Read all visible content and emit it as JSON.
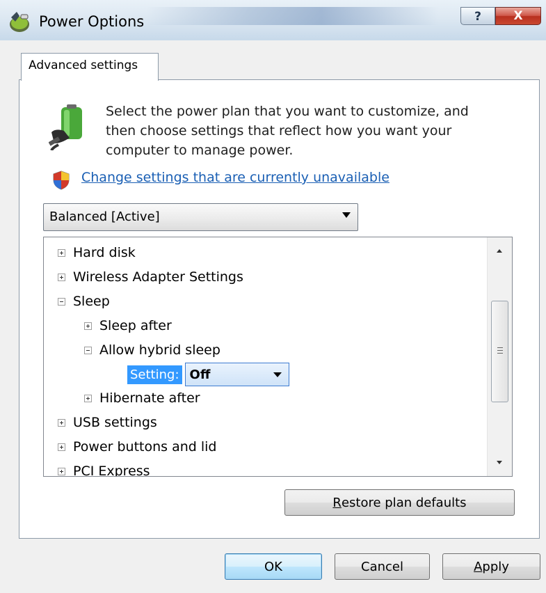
{
  "window": {
    "title": "Power Options",
    "title_icon": "power-options-icon"
  },
  "title_buttons": {
    "help": "?",
    "close": "X"
  },
  "tab": {
    "label": "Advanced settings"
  },
  "description": {
    "lines": [
      "Select the power plan that you want to customize, and",
      "then choose settings that reflect how you want your",
      "computer to manage power."
    ],
    "icon": "power-plug-icon"
  },
  "change_link": {
    "text": "Change settings that are currently unavailable",
    "icon": "uac-shield-icon"
  },
  "plan_select": {
    "value": "Balanced [Active]"
  },
  "tree": {
    "items": [
      {
        "label": "Hard disk",
        "expanded": false,
        "level": 0
      },
      {
        "label": "Wireless Adapter Settings",
        "expanded": false,
        "level": 0
      },
      {
        "label": "Sleep",
        "expanded": true,
        "level": 0
      },
      {
        "label": "Sleep after",
        "expanded": false,
        "level": 1
      },
      {
        "label": "Allow hybrid sleep",
        "expanded": true,
        "level": 1
      },
      {
        "label": "Hibernate after",
        "expanded": false,
        "level": 1
      },
      {
        "label": "USB settings",
        "expanded": false,
        "level": 0
      },
      {
        "label": "Power buttons and lid",
        "expanded": false,
        "level": 0
      },
      {
        "label": "PCI Express",
        "expanded": false,
        "level": 0
      }
    ],
    "setting": {
      "label": "Setting:",
      "value": "Off"
    }
  },
  "buttons": {
    "restore_pre": "",
    "restore_u": "R",
    "restore_rest": "estore plan defaults",
    "ok": "OK",
    "cancel": "Cancel",
    "apply_u": "A",
    "apply_rest": "pply"
  },
  "colors": {
    "link": "#1a5fb4",
    "selection": "#3399ff",
    "close_button": "#c9472f"
  }
}
